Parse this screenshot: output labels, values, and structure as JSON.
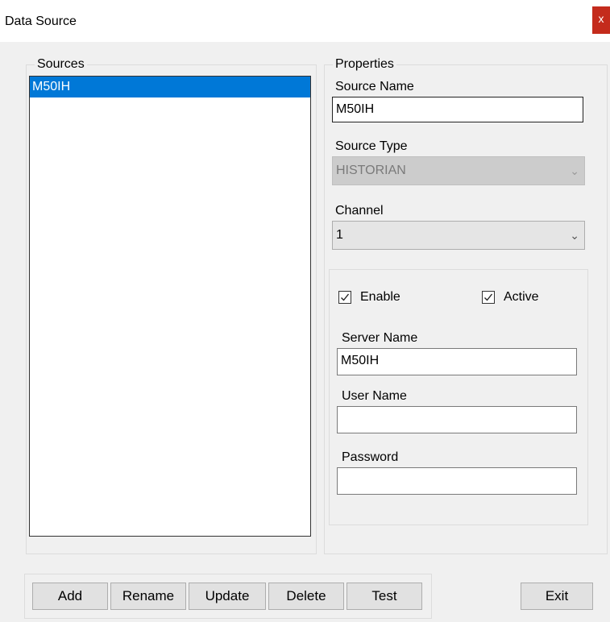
{
  "window": {
    "title": "Data Source",
    "close_glyph": "x"
  },
  "sources": {
    "legend": "Sources",
    "items": [
      "M50IH"
    ]
  },
  "properties": {
    "legend": "Properties",
    "source_name_label": "Source Name",
    "source_name_value": "M50IH",
    "source_type_label": "Source Type",
    "source_type_value": "HISTORIAN",
    "channel_label": "Channel",
    "channel_value": "1",
    "enable_label": "Enable",
    "active_label": "Active",
    "server_name_label": "Server Name",
    "server_name_value": "M50IH",
    "user_name_label": "User Name",
    "user_name_value": "",
    "password_label": "Password",
    "password_value": ""
  },
  "buttons": {
    "add": "Add",
    "rename": "Rename",
    "update": "Update",
    "delete": "Delete",
    "test": "Test",
    "exit": "Exit"
  },
  "colors": {
    "selection": "#0078d7",
    "close": "#c42b1c",
    "client": "#f0f0f0"
  }
}
